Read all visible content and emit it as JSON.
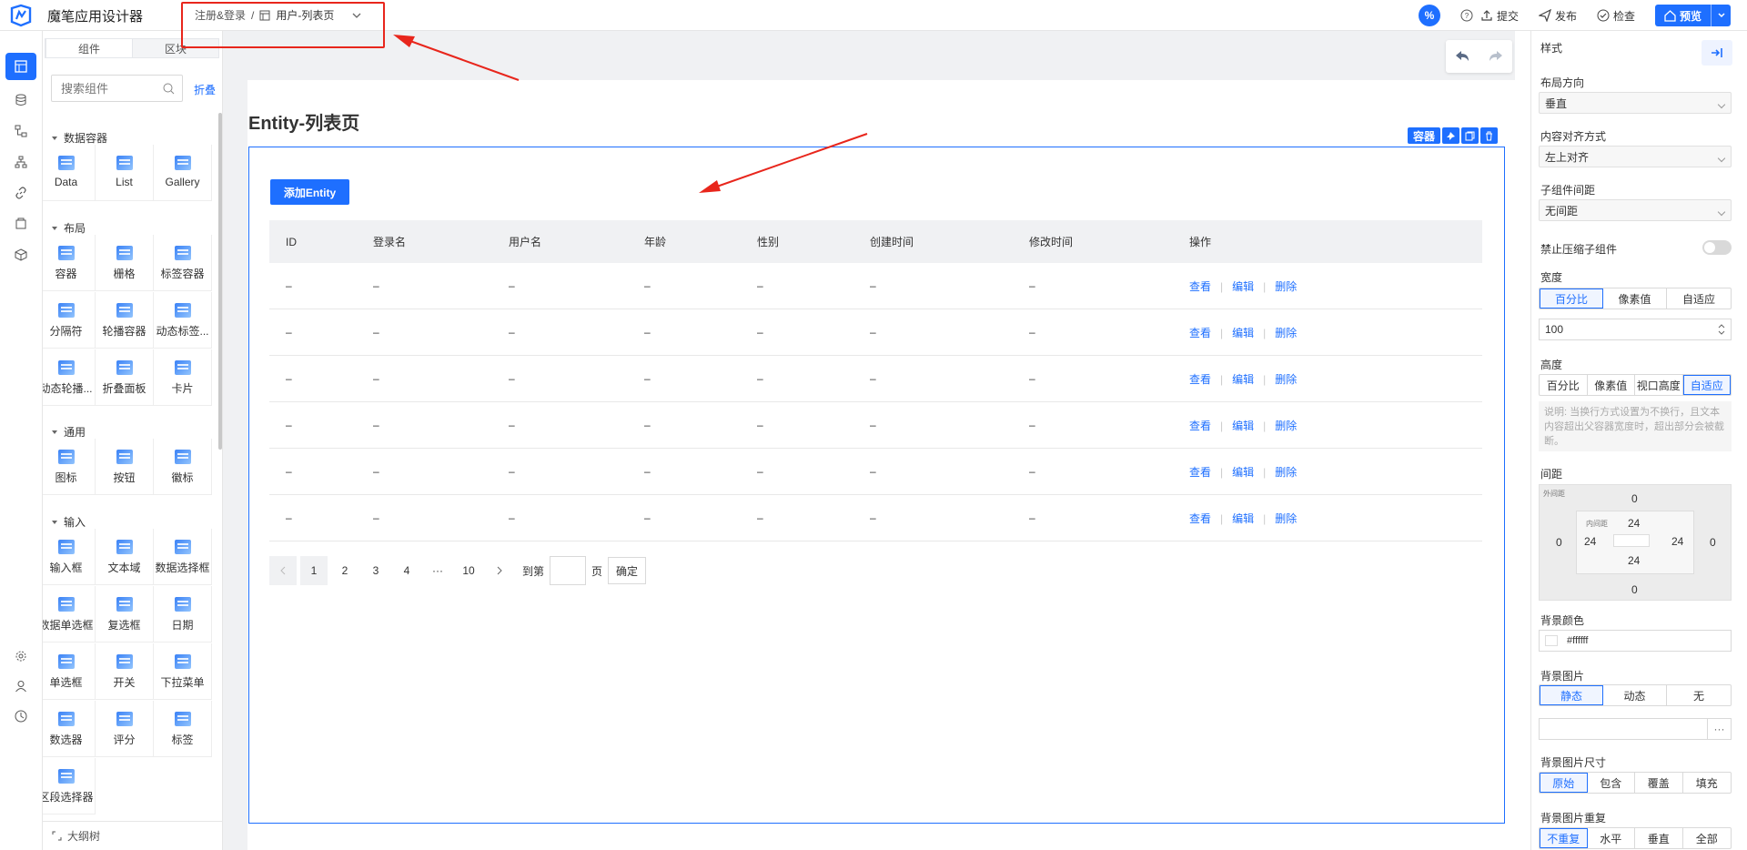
{
  "app": {
    "title": "魔笔应用设计器"
  },
  "breadcrumb": {
    "parent": "注册&登录",
    "separator": "/",
    "page": "用户-列表页"
  },
  "toolbar": {
    "percent_badge": "%",
    "submit": "提交",
    "publish": "发布",
    "check": "检查",
    "preview": "预览"
  },
  "left_panel": {
    "tabs": [
      "组件",
      "区块"
    ],
    "search_placeholder": "搜索组件",
    "fold": "折叠",
    "sections": [
      {
        "title": "数据容器",
        "items": [
          "Data",
          "List",
          "Gallery"
        ]
      },
      {
        "title": "布局",
        "items": [
          "容器",
          "栅格",
          "标签容器",
          "分隔符",
          "轮播容器",
          "动态标签...",
          "动态轮播...",
          "折叠面板",
          "卡片"
        ]
      },
      {
        "title": "通用",
        "items": [
          "图标",
          "按钮",
          "徽标"
        ]
      },
      {
        "title": "输入",
        "items": [
          "输入框",
          "文本域",
          "数据选择框",
          "数据单选框",
          "复选框",
          "日期",
          "单选框",
          "开关",
          "下拉菜单",
          "数选器",
          "评分",
          "标签",
          "区段选择器"
        ]
      }
    ],
    "outline": "大纲树"
  },
  "canvas": {
    "page_title": "Entity-列表页",
    "selection_tag": "容器",
    "add_button": "添加Entity",
    "table": {
      "columns": [
        "ID",
        "登录名",
        "用户名",
        "年龄",
        "性别",
        "创建时间",
        "修改时间",
        "操作"
      ],
      "rows": [
        [
          "–",
          "–",
          "–",
          "–",
          "–",
          "–",
          "–"
        ],
        [
          "–",
          "–",
          "–",
          "–",
          "–",
          "–",
          "–"
        ],
        [
          "–",
          "–",
          "–",
          "–",
          "–",
          "–",
          "–"
        ],
        [
          "–",
          "–",
          "–",
          "–",
          "–",
          "–",
          "–"
        ],
        [
          "–",
          "–",
          "–",
          "–",
          "–",
          "–",
          "–"
        ],
        [
          "–",
          "–",
          "–",
          "–",
          "–",
          "–",
          "–"
        ]
      ],
      "actions": [
        "查看",
        "编辑",
        "删除"
      ]
    },
    "pagination": {
      "pages": [
        "1",
        "2",
        "3",
        "4",
        "···",
        "10"
      ],
      "current": "1",
      "goto_prefix": "到第",
      "goto_suffix": "页",
      "confirm": "确定"
    }
  },
  "right_panel": {
    "title": "样式",
    "layout_direction": {
      "label": "布局方向",
      "value": "垂直"
    },
    "content_align": {
      "label": "内容对齐方式",
      "value": "左上对齐"
    },
    "child_gap": {
      "label": "子组件间距",
      "value": "无间距"
    },
    "no_shrink": {
      "label": "禁止压缩子组件"
    },
    "width": {
      "label": "宽度",
      "options": [
        "百分比",
        "像素值",
        "自适应"
      ],
      "selected": "百分比",
      "value": "100"
    },
    "height": {
      "label": "高度",
      "options": [
        "百分比",
        "像素值",
        "视口高度",
        "自适应"
      ],
      "selected": "自适应"
    },
    "note": "说明: 当换行方式设置为不换行，且文本内容超出父容器宽度时，超出部分会被截断。",
    "spacing": {
      "label": "间距",
      "outer_label": "外间距",
      "inner_label": "内间距",
      "outer": {
        "top": "0",
        "right": "0",
        "bottom": "0",
        "left": "0"
      },
      "inner": {
        "top": "24",
        "right": "24",
        "bottom": "24",
        "left": "24"
      }
    },
    "bg_color": {
      "label": "背景颜色",
      "value": "#ffffff"
    },
    "bg_image": {
      "label": "背景图片",
      "options": [
        "静态",
        "动态",
        "无"
      ],
      "selected": "静态",
      "more": "···"
    },
    "bg_size": {
      "label": "背景图片尺寸",
      "options": [
        "原始",
        "包含",
        "覆盖",
        "填充"
      ],
      "selected": "原始"
    },
    "bg_repeat": {
      "label": "背景图片重复",
      "options": [
        "不重复",
        "水平",
        "垂直",
        "全部"
      ],
      "selected": "不重复"
    }
  },
  "colors": {
    "accent": "#1e6fff",
    "annotation": "#e8261c"
  }
}
